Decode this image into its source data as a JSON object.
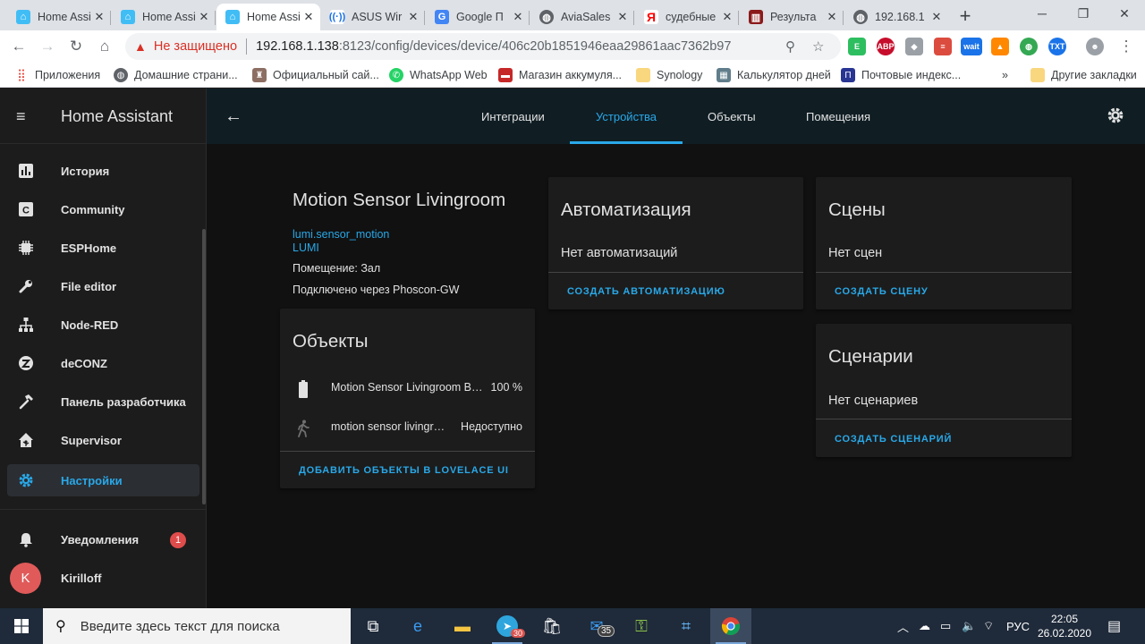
{
  "browser": {
    "tabs": [
      {
        "title": "Home Assi",
        "icon": "home-assistant-icon",
        "color": "#41bdf5",
        "active": false
      },
      {
        "title": "Home Assi",
        "icon": "home-assistant-icon",
        "color": "#41bdf5",
        "active": false
      },
      {
        "title": "Home Assi",
        "icon": "home-assistant-icon",
        "color": "#41bdf5",
        "active": true
      },
      {
        "title": "ASUS Wir",
        "icon": "wireless-icon",
        "color": "#1a73e8",
        "active": false
      },
      {
        "title": "Google П",
        "icon": "google-translate-icon",
        "color": "#4285f4",
        "active": false
      },
      {
        "title": "AviaSales",
        "icon": "globe-icon",
        "color": "#5f6368",
        "active": false
      },
      {
        "title": "судебные",
        "icon": "yandex-icon",
        "color": "#ff0000",
        "active": false
      },
      {
        "title": "Результа",
        "icon": "court-icon",
        "color": "#8b1a1a",
        "active": false
      },
      {
        "title": "192.168.1",
        "icon": "globe-icon",
        "color": "#5f6368",
        "active": false
      }
    ],
    "address": {
      "security_label": "Не защищено",
      "url_host": "192.168.1.138",
      "url_rest": ":8123/config/devices/device/406c20b1851946eaa29861aac7362b97"
    },
    "extensions": [
      {
        "name": "evernote-icon",
        "label": "",
        "color": "#2dbe60"
      },
      {
        "name": "adblock-icon",
        "label": "ABP",
        "color": "#c70d2c"
      },
      {
        "name": "dropbox-icon",
        "label": "",
        "color": "#9aa0a6"
      },
      {
        "name": "todoist-icon",
        "label": "",
        "color": "#db4c3f"
      },
      {
        "name": "wait-icon",
        "label": "wait",
        "color": "#1a73e8"
      },
      {
        "name": "vlc-icon",
        "label": "",
        "color": "#ff8800"
      },
      {
        "name": "earth-icon",
        "label": "",
        "color": "#34a853"
      },
      {
        "name": "jtxt-icon",
        "label": "TXT",
        "color": "#1a73e8"
      },
      {
        "name": "car-icon",
        "label": "",
        "color": "#9aa0a6"
      }
    ],
    "bookmarks": [
      {
        "label": "Приложения",
        "icon": "apps-grid-icon",
        "color": "#e94235"
      },
      {
        "label": "Домашние страни...",
        "icon": "globe-icon",
        "color": "#5f6368"
      },
      {
        "label": "Официальный сай...",
        "icon": "emblem-icon",
        "color": "#8d6e63"
      },
      {
        "label": "WhatsApp Web",
        "icon": "whatsapp-icon",
        "color": "#25d366"
      },
      {
        "label": "Магазин аккумуля...",
        "icon": "truck-icon",
        "color": "#c62828"
      },
      {
        "label": "Synology",
        "icon": "folder-icon",
        "color": "#f9d77e"
      },
      {
        "label": "Калькулятор дней",
        "icon": "calculator-icon",
        "color": "#607d8b"
      },
      {
        "label": "Почтовые индекс...",
        "icon": "post-icon",
        "color": "#283593"
      }
    ],
    "bookmarks_more": "»",
    "other_bookmarks": "Другие закладки"
  },
  "sidebar": {
    "title": "Home Assistant",
    "items": [
      {
        "label": "История",
        "icon": "history-chart-icon",
        "selected": false
      },
      {
        "label": "Community",
        "icon": "community-icon",
        "selected": false
      },
      {
        "label": "ESPHome",
        "icon": "chip-icon",
        "selected": false
      },
      {
        "label": "File editor",
        "icon": "wrench-icon",
        "selected": false
      },
      {
        "label": "Node-RED",
        "icon": "sitemap-icon",
        "selected": false
      },
      {
        "label": "deCONZ",
        "icon": "zigbee-icon",
        "selected": false
      },
      {
        "label": "Панель разработчика",
        "icon": "hammer-icon",
        "selected": false
      },
      {
        "label": "Supervisor",
        "icon": "home-assistant-icon",
        "selected": false
      },
      {
        "label": "Настройки",
        "icon": "gear-icon",
        "selected": true
      }
    ],
    "notifications": {
      "label": "Уведомления",
      "count": "1"
    },
    "user": {
      "name": "Kirilloff",
      "initial": "K"
    }
  },
  "topnav": {
    "tabs": [
      "Интеграции",
      "Устройства",
      "Объекты",
      "Помещения"
    ],
    "active_index": 1
  },
  "device": {
    "name": "Motion Sensor Livingroom",
    "model": "lumi.sensor_motion",
    "manufacturer": "LUMI",
    "area": "Помещение: Зал",
    "via": "Подключено через Phoscon-GW"
  },
  "entities_card": {
    "title": "Объекты",
    "rows": [
      {
        "name": "Motion Sensor Livingroom Battery Level",
        "state": "100 %",
        "icon": "battery-icon"
      },
      {
        "name": "motion sensor livingroom",
        "state": "Недоступно",
        "icon": "walk-icon"
      }
    ],
    "action": "ДОБАВИТЬ ОБЪЕКТЫ В LOVELACE UI"
  },
  "automation_card": {
    "title": "Автоматизация",
    "empty": "Нет автоматизаций",
    "action": "СОЗДАТЬ АВТОМАТИЗАЦИЮ"
  },
  "scenes_card": {
    "title": "Сцены",
    "empty": "Нет сцен",
    "action": "СОЗДАТЬ СЦЕНУ"
  },
  "scripts_card": {
    "title": "Сценарии",
    "empty": "Нет сценариев",
    "action": "СОЗДАТЬ СЦЕНАРИЙ"
  },
  "taskbar": {
    "search_placeholder": "Введите здесь текст для поиска",
    "telegram_badge": "30",
    "mail_badge": "35",
    "language": "РУС",
    "time": "22:05",
    "date": "26.02.2020"
  },
  "colors": {
    "accent": "#29a8e8",
    "card": "#1c1c1c",
    "badge": "#df4c4c"
  }
}
